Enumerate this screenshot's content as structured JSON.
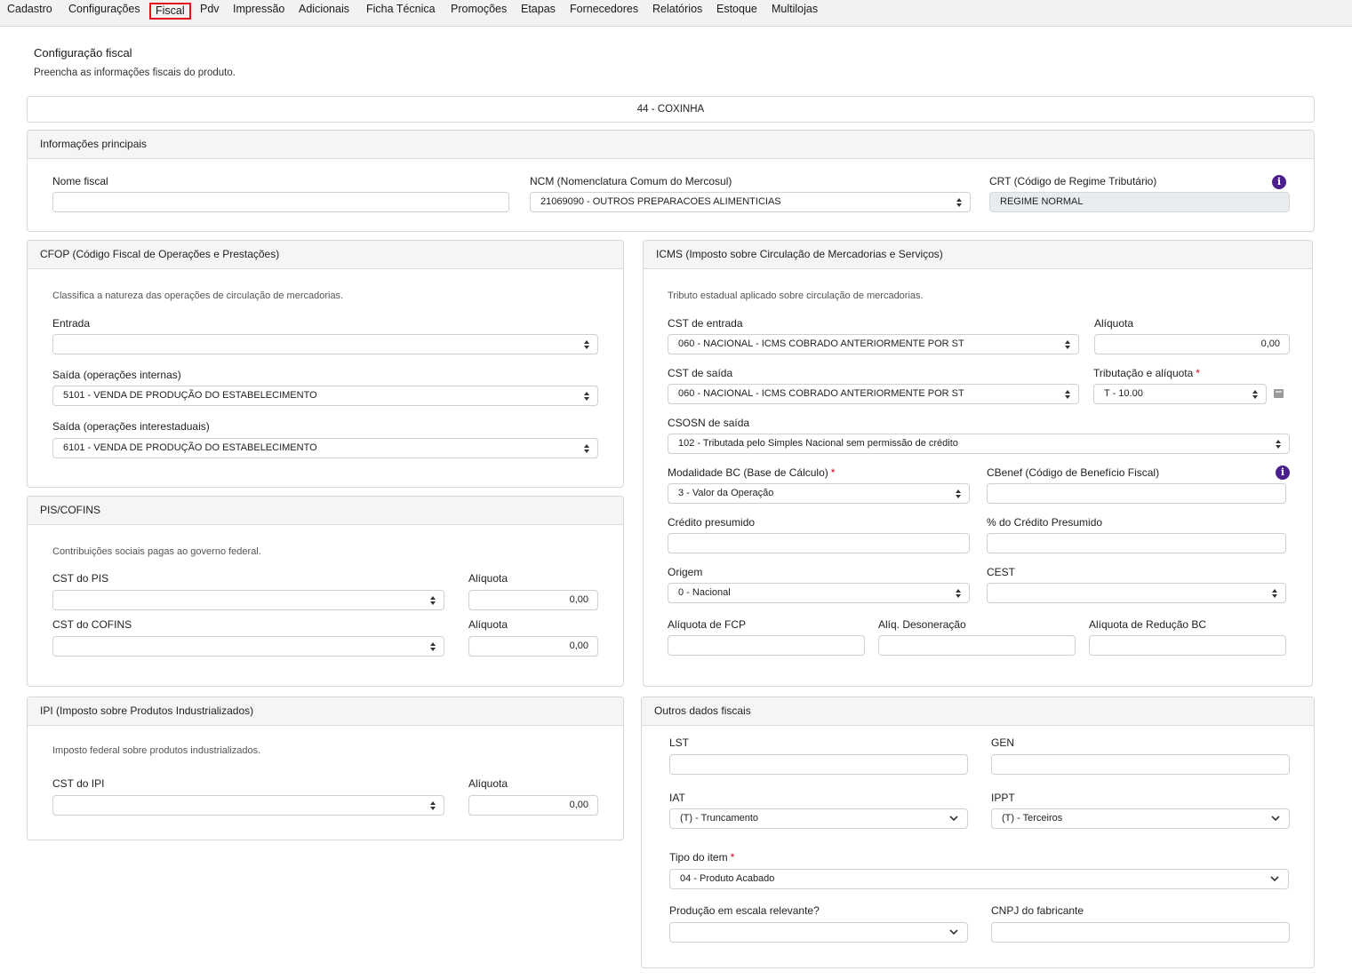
{
  "tabs": [
    {
      "label": "Cadastro"
    },
    {
      "label": "Configurações"
    },
    {
      "label": "Fiscal"
    },
    {
      "label": "Pdv"
    },
    {
      "label": "Impressão"
    },
    {
      "label": "Adicionais"
    },
    {
      "label": "Ficha Técnica"
    },
    {
      "label": "Promoções"
    },
    {
      "label": "Etapas"
    },
    {
      "label": "Fornecedores"
    },
    {
      "label": "Relatórios"
    },
    {
      "label": "Estoque"
    },
    {
      "label": "Multilojas"
    }
  ],
  "page": {
    "title": "Configuração fiscal",
    "subtitle": "Preencha as informações fiscais do produto.",
    "product": "44 - COXINHA"
  },
  "principais": {
    "header": "Informações principais",
    "nome_fiscal_label": "Nome fiscal",
    "nome_fiscal_value": "",
    "ncm_label": "NCM (Nomenclatura Comum do Mercosul)",
    "ncm_value": "21069090 - OUTROS PREPARACOES ALIMENTICIAS",
    "crt_label": "CRT (Código de Regime Tributário)",
    "crt_value": "REGIME NORMAL"
  },
  "cfop": {
    "header": "CFOP (Código Fiscal de Operações e Prestações)",
    "description": "Classifica a natureza das operações de circulação de mercadorias.",
    "entrada_label": "Entrada",
    "entrada_value": "",
    "saida_int_label": "Saída (operações internas)",
    "saida_int_value": "5101 - VENDA DE PRODUÇÃO DO ESTABELECIMENTO",
    "saida_inter_label": "Saída (operações interestaduais)",
    "saida_inter_value": "6101 - VENDA DE PRODUÇÃO DO ESTABELECIMENTO"
  },
  "pis": {
    "header": "PIS/COFINS",
    "description": "Contribuições sociais pagas ao governo federal.",
    "cst_pis_label": "CST do PIS",
    "cst_pis_value": "",
    "aliq_pis_label": "Alíquota",
    "aliq_pis_value": "0,00",
    "cst_cofins_label": "CST do COFINS",
    "cst_cofins_value": "",
    "aliq_cofins_label": "Alíquota",
    "aliq_cofins_value": "0,00"
  },
  "ipi": {
    "header": "IPI (Imposto sobre Produtos Industrializados)",
    "description": "Imposto federal sobre produtos industrializados.",
    "cst_label": "CST do IPI",
    "cst_value": "",
    "aliq_label": "Alíquota",
    "aliq_value": "0,00"
  },
  "icms": {
    "header": "ICMS (Imposto sobre Circulação de Mercadorias e Serviços)",
    "description": "Tributo estadual aplicado sobre circulação de mercadorias.",
    "cst_entrada_label": "CST de entrada",
    "cst_entrada_value": "060 - NACIONAL - ICMS COBRADO ANTERIORMENTE POR ST",
    "aliq_label": "Alíquota",
    "aliq_value": "0,00",
    "cst_saida_label": "CST de saída",
    "cst_saida_value": "060 - NACIONAL - ICMS COBRADO ANTERIORMENTE POR ST",
    "trib_label": "Tributação e alíquota",
    "trib_value": "T - 10.00",
    "csosn_label": "CSOSN de saída",
    "csosn_value": "102 - Tributada pelo Simples Nacional sem permissão de crédito",
    "mod_bc_label": "Modalidade BC (Base de Cálculo)",
    "mod_bc_value": "3 - Valor da Operação",
    "cbenef_label": "CBenef (Código de Benefício Fiscal)",
    "cbenef_value": "",
    "cred_label": "Crédito presumido",
    "cred_value": "",
    "pct_cred_label": "% do Crédito Presumido",
    "pct_cred_value": "",
    "origem_label": "Origem",
    "origem_value": "0 - Nacional",
    "cest_label": "CEST",
    "cest_value": "",
    "fcp_label": "Alíquota de FCP",
    "fcp_value": "",
    "deson_label": "Alíq. Desoneração",
    "deson_value": "",
    "red_bc_label": "Alíquota de Redução BC",
    "red_bc_value": ""
  },
  "outros": {
    "header": "Outros dados fiscais",
    "lst_label": "LST",
    "lst_value": "",
    "gen_label": "GEN",
    "gen_value": "",
    "iat_label": "IAT",
    "iat_value": "(T) - Truncamento",
    "ippt_label": "IPPT",
    "ippt_value": "(T) - Terceiros",
    "tipo_label": "Tipo do item",
    "tipo_value": "04 - Produto Acabado",
    "escala_label": "Produção em escala relevante?",
    "escala_value": "",
    "cnpj_label": "CNPJ do fabricante",
    "cnpj_value": ""
  },
  "required_mark": "*",
  "info_glyph": "i",
  "colors": {
    "active_tab_border": "#e1101b",
    "info_icon": "#4b1f8c",
    "required": "#d0021b"
  }
}
